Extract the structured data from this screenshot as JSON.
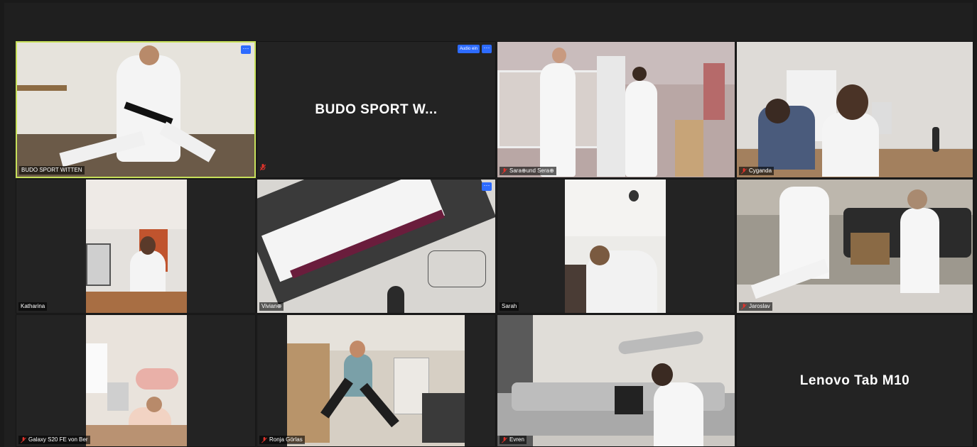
{
  "tiles": [
    {
      "name": "BUDO SPORT WITTEN",
      "more": "···"
    },
    {
      "name": "BUDO SPORT W...",
      "audio_button": "Audio ein",
      "more": "···"
    },
    {
      "name": "Sara⊕und Sera⊕"
    },
    {
      "name": "Cyganda"
    },
    {
      "name": "Katharina"
    },
    {
      "name": "Vivian⊕",
      "more": "···"
    },
    {
      "name": "Sarah"
    },
    {
      "name": "Jaroslav"
    },
    {
      "name": "Galaxy S20 FE von Ber"
    },
    {
      "name": "Ronja Görlas"
    },
    {
      "name": "Evren"
    },
    {
      "name": "Lenovo Tab M10"
    }
  ],
  "colors": {
    "active_speaker_border": "#c7e05a",
    "muted_mic": "#e0332b",
    "button_blue": "#2d6bff"
  }
}
